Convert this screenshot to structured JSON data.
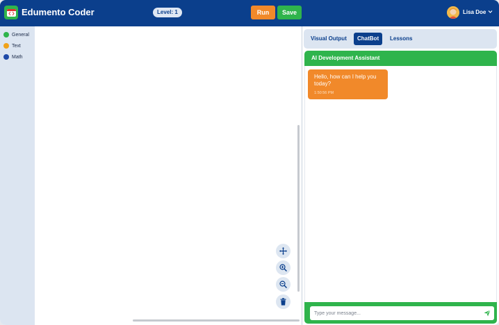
{
  "header": {
    "app_title": "Edumento Coder",
    "level_label": "Level: 1",
    "run_label": "Run",
    "save_label": "Save",
    "user_name": "Lisa Doe"
  },
  "sidebar": {
    "categories": [
      {
        "label": "General",
        "color": "#2fb44c"
      },
      {
        "label": "Text",
        "color": "#f0a21b"
      },
      {
        "label": "Math",
        "color": "#1f4aa8"
      }
    ]
  },
  "workspace": {
    "tools": [
      "move-icon",
      "zoom-in-icon",
      "zoom-out-icon",
      "trash-icon"
    ]
  },
  "right_panel": {
    "tabs": [
      {
        "label": "Visual Output",
        "active": false
      },
      {
        "label": "ChatBot",
        "active": true
      },
      {
        "label": "Lessons",
        "active": false
      }
    ],
    "chat_title": "AI Development Assistant",
    "messages": [
      {
        "text": "Hello, how can I help you today?",
        "time": "1:50:56 PM"
      }
    ],
    "input_placeholder": "Type your message..."
  },
  "colors": {
    "header_bg": "#0b3f8c",
    "accent_green": "#2fb44c",
    "accent_orange": "#f1892a",
    "sidebar_bg": "#dce5f1"
  }
}
